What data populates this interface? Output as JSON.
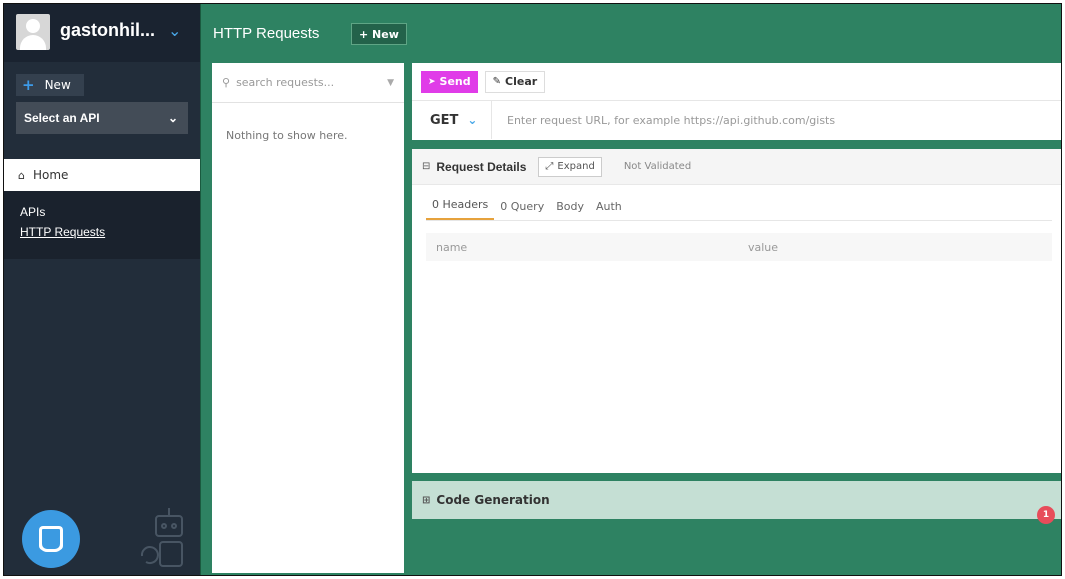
{
  "user": {
    "name": "gastonhil..."
  },
  "sidebar": {
    "new_label": "New",
    "api_select": "Select an API",
    "home_label": "Home",
    "links": [
      "APIs",
      "HTTP Requests"
    ]
  },
  "header": {
    "title": "HTTP Requests",
    "new_label": "+ New"
  },
  "list": {
    "search_placeholder": "search requests...",
    "empty_message": "Nothing to show here."
  },
  "request": {
    "send_label": "Send",
    "clear_label": "Clear",
    "method": "GET",
    "url_placeholder": "Enter request URL, for example https://api.github.com/gists"
  },
  "details": {
    "title": "Request Details",
    "expand_label": "Expand",
    "status": "Not Validated",
    "tabs": [
      "0 Headers",
      "0 Query",
      "Body",
      "Auth"
    ],
    "active_tab": "0 Headers",
    "columns": [
      "name",
      "value"
    ]
  },
  "codegen": {
    "title": "Code Generation"
  },
  "notification": {
    "count": "1"
  },
  "colors": {
    "sidebar_bg": "#222d3a",
    "main_bg": "#2e8262",
    "send_button": "#e03ce8",
    "accent_blue": "#3b9ae1",
    "active_tab_underline": "#e6a23c",
    "badge_red": "#e74c5a"
  },
  "icons": {
    "user_menu": "chevron-down-icon",
    "new": "plus-icon",
    "home": "home-icon",
    "search": "search-icon",
    "filter": "filter-icon",
    "send": "send-icon",
    "clear": "eraser-icon",
    "expand": "expand-icon",
    "chat": "chat-icon"
  }
}
